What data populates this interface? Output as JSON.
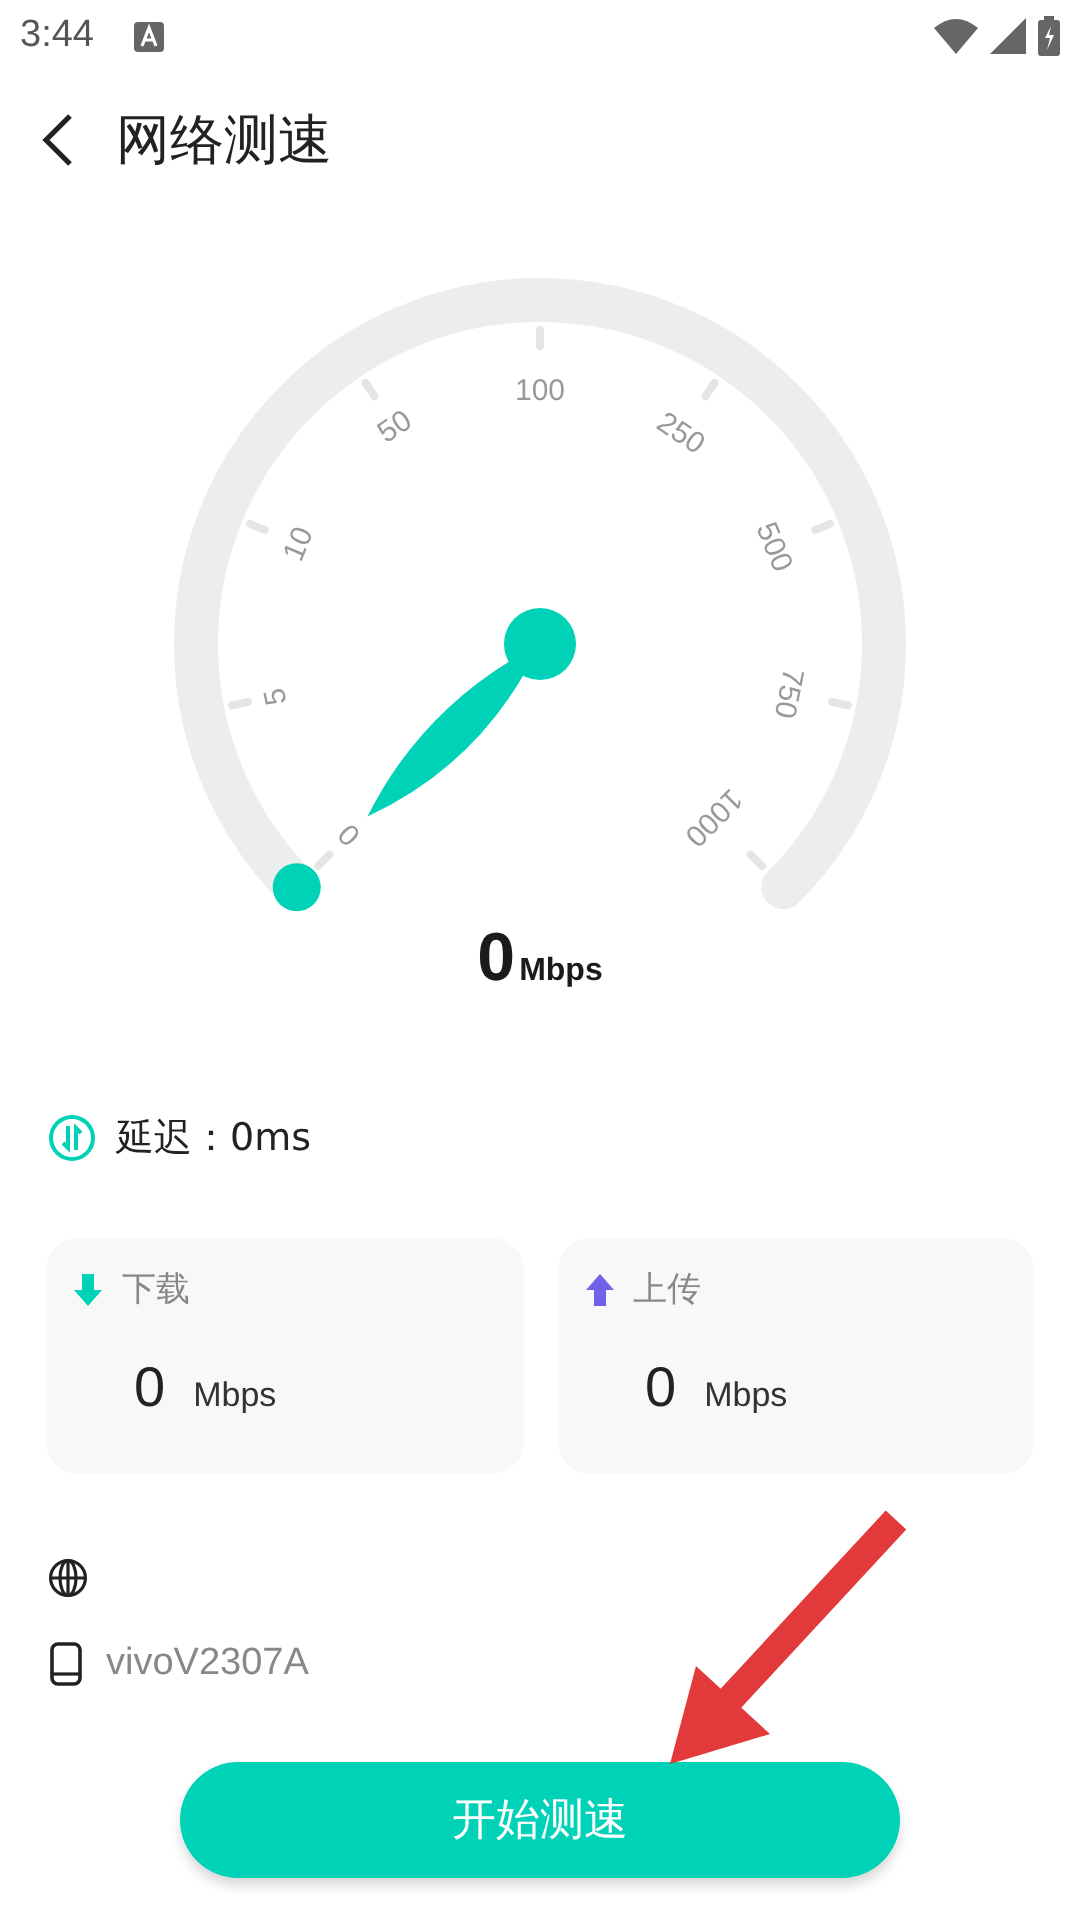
{
  "status_bar": {
    "time": "3:44"
  },
  "header": {
    "title": "网络测速"
  },
  "gauge": {
    "scale_labels": [
      "0",
      "5",
      "10",
      "50",
      "100",
      "250",
      "500",
      "750",
      "1000"
    ],
    "reading": "0",
    "unit": "Mbps"
  },
  "latency": {
    "label": "延迟：0ms"
  },
  "stats": [
    {
      "kind": "download",
      "label": "下载",
      "value": "0",
      "unit": "Mbps"
    },
    {
      "kind": "upload",
      "label": "上传",
      "value": "0",
      "unit": "Mbps"
    }
  ],
  "device": {
    "name": "vivoV2307A"
  },
  "start_button": {
    "label": "开始测速"
  }
}
